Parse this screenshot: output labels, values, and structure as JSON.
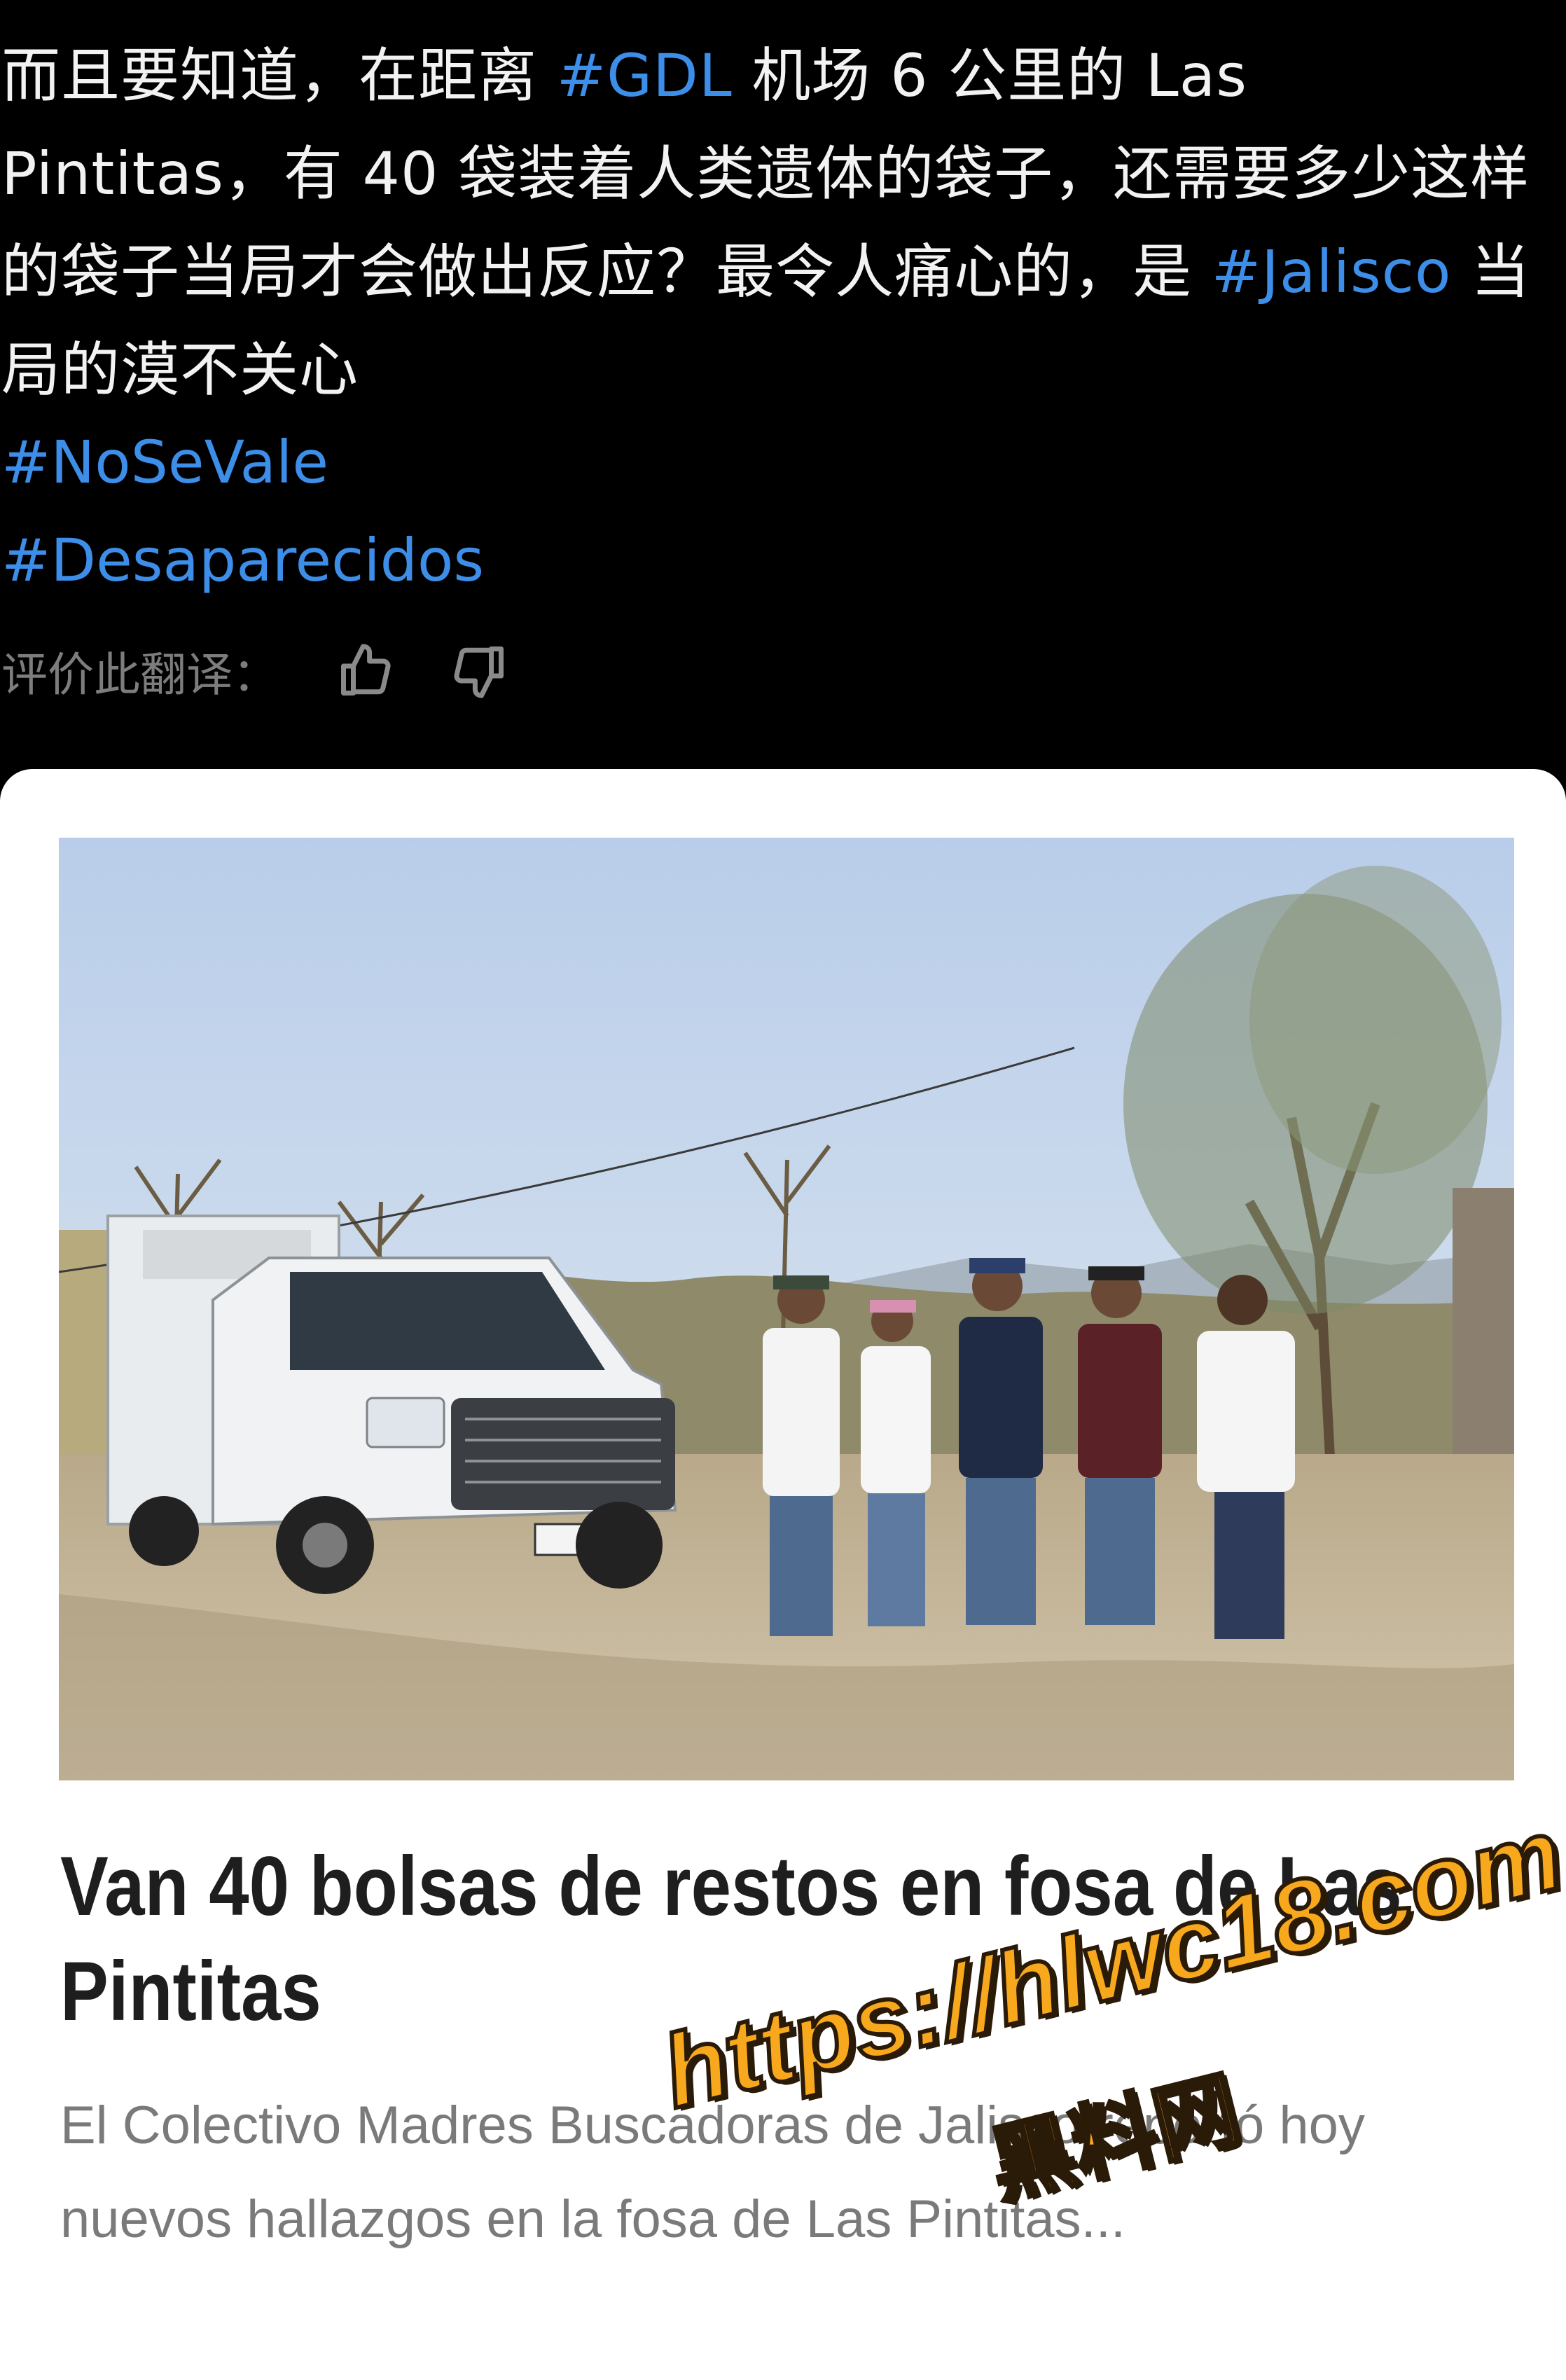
{
  "post": {
    "text_segments": [
      {
        "text": "而且要知道，在距离 ",
        "hashtag": false
      },
      {
        "text": "#GDL",
        "hashtag": true
      },
      {
        "text": " 机场 6 公里的 Las Pintitas，有 40 袋装着人类遗体的袋子，还需要多少这样的袋子当局才会做出反应？最令人痛心的，是 ",
        "hashtag": false
      },
      {
        "text": "#Jalisco",
        "hashtag": true
      },
      {
        "text": " 当局的漠不关心",
        "hashtag": false
      }
    ],
    "tags": [
      "#NoSeVale",
      "#Desaparecidos"
    ]
  },
  "translation_rating": {
    "label": "评价此翻译：",
    "thumbs_up_icon": "thumbs-up-icon",
    "thumbs_down_icon": "thumbs-down-icon"
  },
  "link_card": {
    "image_icon": "news-photo-truck-and-group",
    "title": "Van 40 bolsas de restos en fosa de Las Pintitas",
    "description": "El Colectivo Madres Buscadoras de Jalisco reportó hoy nuevos hallazgos en la fosa de Las Pintitas..."
  },
  "watermark": {
    "url": "https://hlwc18.com",
    "label": "黑料网"
  },
  "colors": {
    "background": "#000000",
    "text": "#f2f2f2",
    "hashtag": "#3d8ee8",
    "muted": "#7d7d7d",
    "card_bg": "#ffffff",
    "headline": "#1e1e1e",
    "watermark": "#f7a81d"
  }
}
